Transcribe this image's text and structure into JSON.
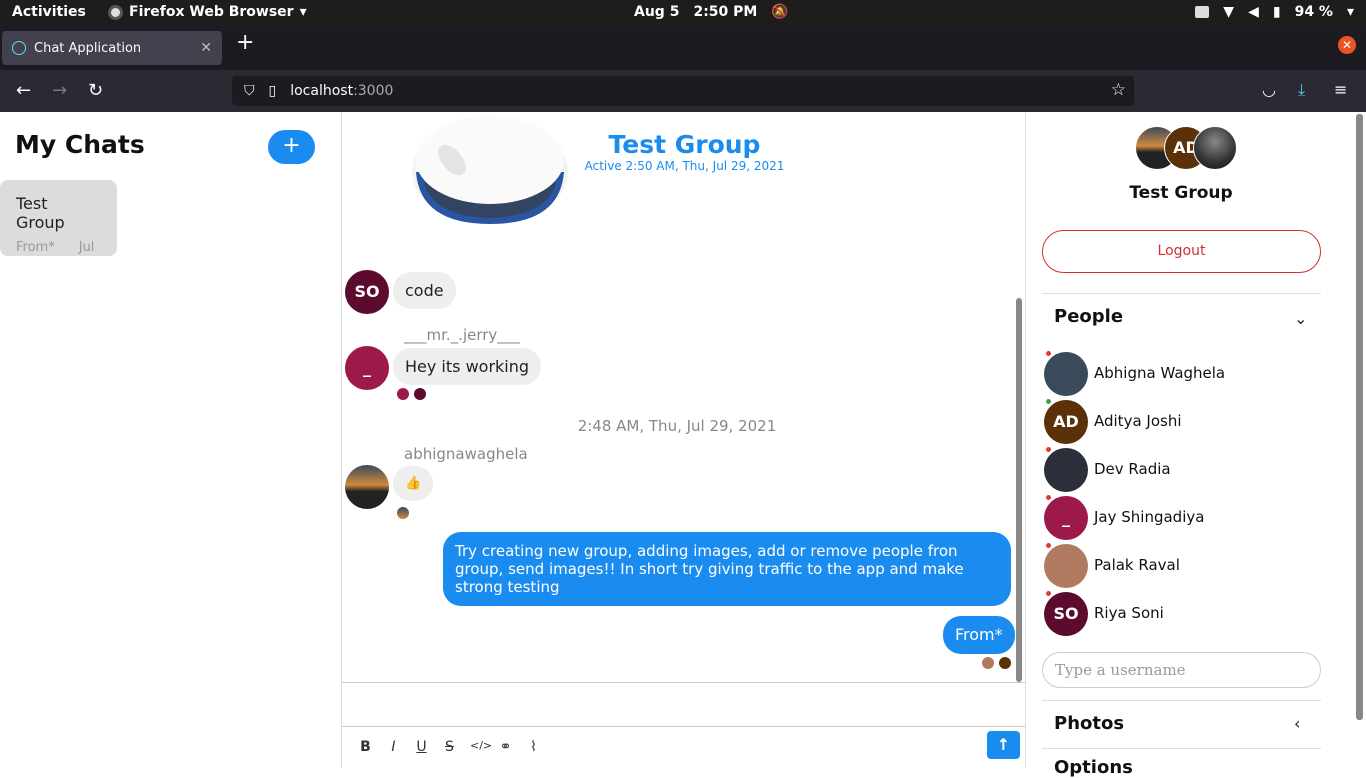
{
  "system_bar": {
    "activities": "Activities",
    "app_name": "Firefox Web Browser",
    "date": "Aug 5",
    "time": "2:50 PM",
    "battery": "94 %"
  },
  "browser": {
    "tab_title": "Chat Application",
    "new_tab": "+",
    "url_host": "localhost",
    "url_port": ":3000"
  },
  "chats_sidebar": {
    "title": "My Chats",
    "add_label": "+",
    "items": [
      {
        "name": "Test Group",
        "preview": "From*",
        "date": "Jul"
      }
    ]
  },
  "chat": {
    "title": "Test Group",
    "active": "Active 2:50 AM, Thu, Jul 29, 2021",
    "messages": [
      {
        "avatar": "SO",
        "text": "code"
      },
      {
        "sender": "___mr._.jerry___",
        "avatar": "_",
        "text": "Hey its working"
      },
      {
        "separator": "2:48 AM, Thu, Jul 29, 2021"
      },
      {
        "sender": "abhignawaghela",
        "text": "👍"
      },
      {
        "text": "Try creating new group, adding images, add or remove people fron group, send images!! In short try giving traffic to the app and make strong testing"
      },
      {
        "text": "From*"
      }
    ],
    "send_label": "↑"
  },
  "details": {
    "avatar_initials": "AD",
    "title": "Test Group",
    "logout": "Logout",
    "people_heading": "People",
    "people": [
      {
        "name": "Abhigna Waghela",
        "initials": "",
        "color": "#3a4a5a",
        "dot": "#e53935"
      },
      {
        "name": "Aditya Joshi",
        "initials": "AD",
        "color": "#5a3108",
        "dot": "#43a047"
      },
      {
        "name": "Dev Radia",
        "initials": "",
        "color": "#2a2f3a",
        "dot": "#e53935"
      },
      {
        "name": "Jay Shingadiya",
        "initials": "_",
        "color": "#9b1a4b",
        "dot": "#e53935"
      },
      {
        "name": "Palak Raval",
        "initials": "",
        "color": "#b07a60",
        "dot": "#e53935"
      },
      {
        "name": "Riya Soni",
        "initials": "SO",
        "color": "#5c0a2e",
        "dot": "#e53935"
      }
    ],
    "search_placeholder": "Type a username",
    "photos_heading": "Photos",
    "options_heading": "Options"
  },
  "colors": {
    "accent": "#1a8cf0",
    "logout_red": "#d32f2f"
  }
}
